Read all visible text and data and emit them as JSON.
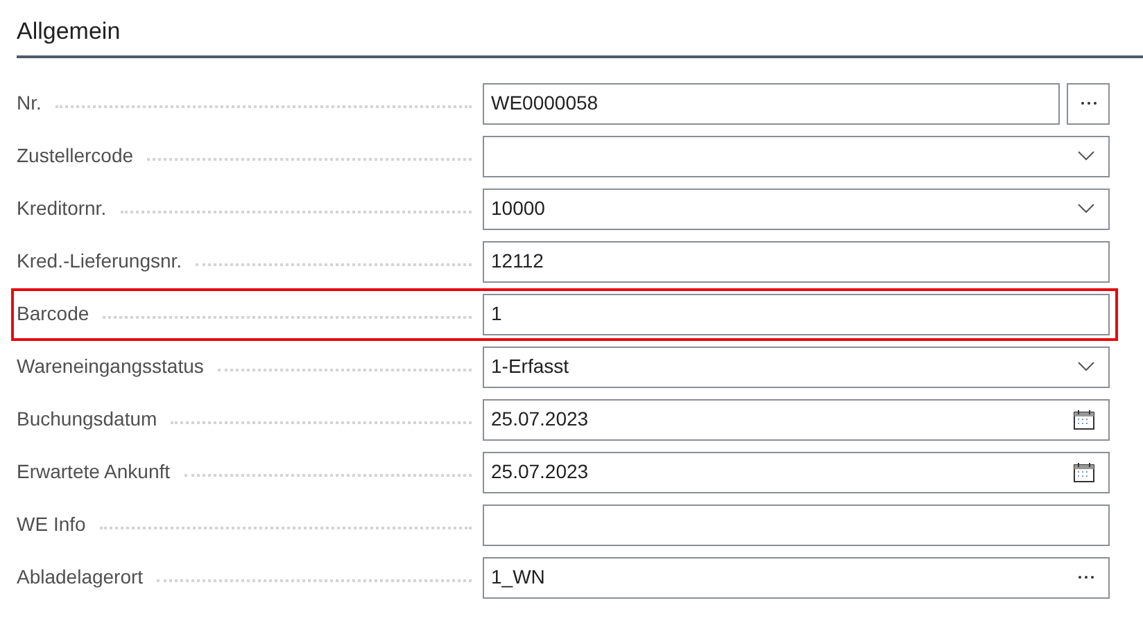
{
  "section": {
    "title": "Allgemein"
  },
  "fields": [
    {
      "label": "Nr.",
      "kind": "lookup-button",
      "value": "WE0000058",
      "highlighted": false
    },
    {
      "label": "Zustellercode",
      "kind": "dropdown",
      "highlighted": false
    },
    {
      "label": "Kreditornr.",
      "kind": "dropdown",
      "value": "10000",
      "highlighted": false
    },
    {
      "label": "Kred.-Lieferungsnr.",
      "kind": "text",
      "value": "12112",
      "highlighted": false
    },
    {
      "label": "Barcode",
      "kind": "text",
      "value": "1",
      "highlighted": true
    },
    {
      "label": "Wareneingangsstatus",
      "kind": "dropdown",
      "value": "1-Erfasst",
      "highlighted": false
    },
    {
      "label": "Buchungsdatum",
      "kind": "date",
      "value": "25.07.2023",
      "highlighted": false
    },
    {
      "label": "Erwartete Ankunft",
      "kind": "date",
      "value": "25.07.2023",
      "highlighted": false
    },
    {
      "label": "WE Info",
      "kind": "text",
      "highlighted": false
    },
    {
      "label": "Abladelagerort",
      "kind": "lookup",
      "value": "1_WN",
      "highlighted": false
    }
  ]
}
